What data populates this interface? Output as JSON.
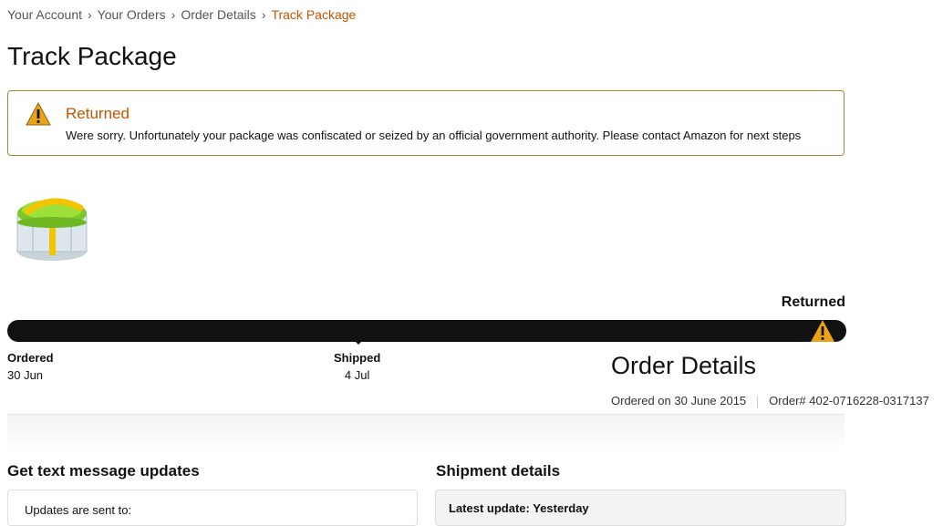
{
  "breadcrumb": {
    "items": [
      "Your Account",
      "Your Orders",
      "Order Details"
    ],
    "separator": "›",
    "current": "Track Package"
  },
  "page_title": "Track Package",
  "alert": {
    "icon": "warning-icon",
    "title": "Returned",
    "message": "Were sorry. Unfortunately your package was confiscated or seized by an official government authority. Please contact Amazon for next steps"
  },
  "tracking": {
    "status": "Returned",
    "milestones": [
      {
        "label": "Ordered",
        "date": "30 Jun"
      },
      {
        "label": "Shipped",
        "date": "4 Jul"
      }
    ],
    "end_icon": "warning-icon"
  },
  "order_details": {
    "title": "Order Details",
    "ordered_on": "Ordered on 30 June 2015",
    "order_number": "Order# 402-0716228-0317137"
  },
  "sms": {
    "title": "Get text message updates",
    "text": "Updates are sent to:"
  },
  "shipment": {
    "title": "Shipment details",
    "latest_update": "Latest update: Yesterday"
  },
  "colors": {
    "accent": "#c45500",
    "alert_border": "#a88734",
    "progress_bar": "#111111",
    "warning_yellow": "#e8a317"
  }
}
